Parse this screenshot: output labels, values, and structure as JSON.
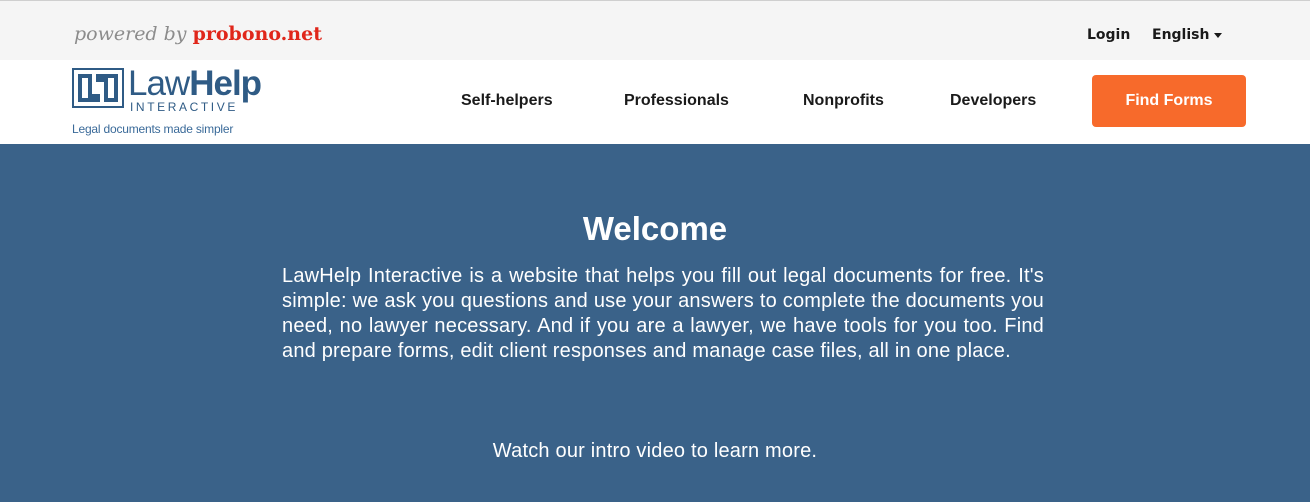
{
  "topbar": {
    "powered_prefix": "powered by",
    "powered_brand": "probono.net",
    "login": "Login",
    "language": "English"
  },
  "logo": {
    "word_law": "Law",
    "word_help": "Help",
    "word_interactive": "INTERACTIVE",
    "tagline": "Legal documents made simpler"
  },
  "nav": {
    "items": [
      "Self-helpers",
      "Professionals",
      "Nonprofits",
      "Developers"
    ],
    "cta": "Find Forms"
  },
  "hero": {
    "title": "Welcome",
    "body": "LawHelp Interactive is a website that helps you fill out legal documents for free. It's simple: we ask you questions and use your answers to complete the documents you need, no lawyer necessary. And if you are a lawyer, we have tools for you too. Find and prepare forms, edit client responses and manage case files, all in one place.",
    "cta": "Watch our intro video to learn more."
  },
  "colors": {
    "hero_bg": "#3a6289",
    "cta_bg": "#f76a2b",
    "brand_red": "#e0261a",
    "logo_blue": "#2f5b85"
  },
  "icons": {
    "logo_mark": "lawhelp-logo-mark",
    "language_caret": "caret-down-icon"
  }
}
